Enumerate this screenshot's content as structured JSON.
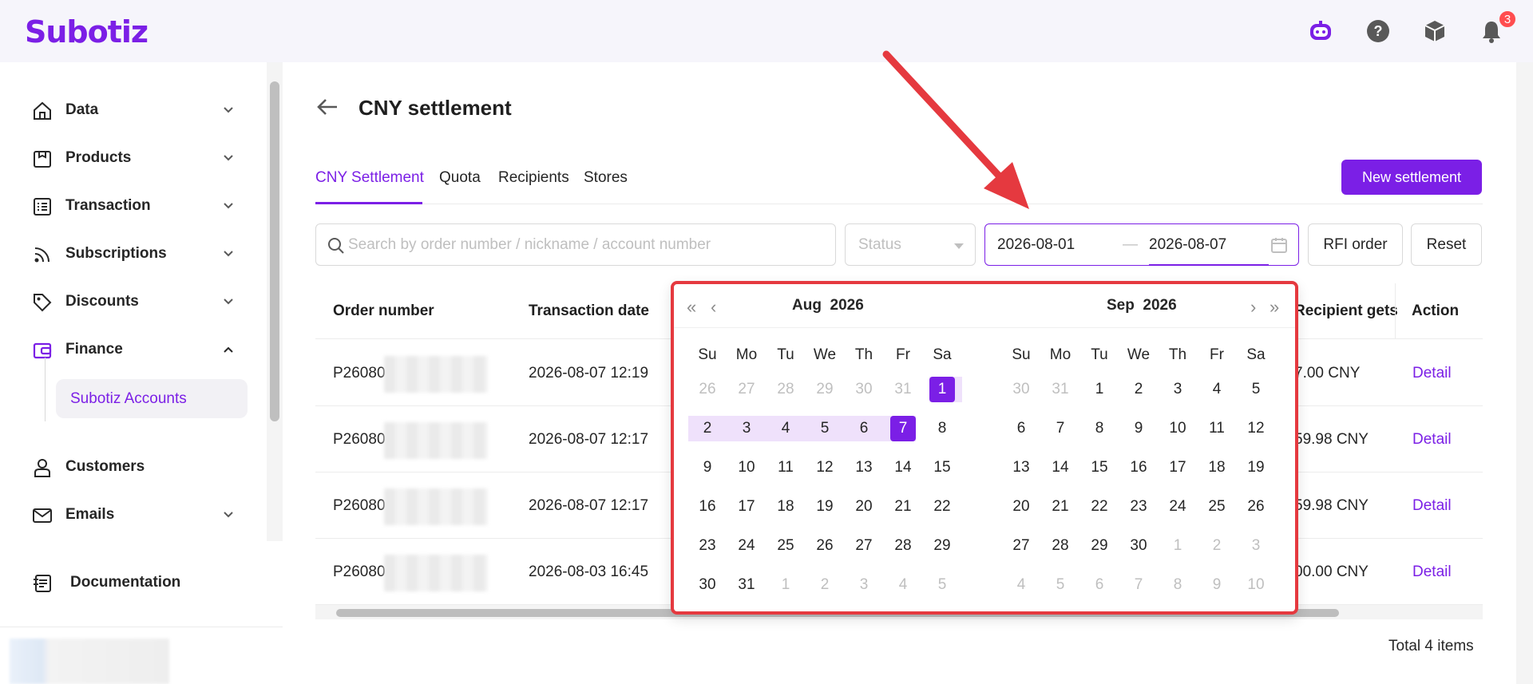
{
  "app": {
    "logo": "Subotiz",
    "notification_count": "3"
  },
  "sidebar": {
    "items": [
      {
        "label": "Data",
        "icon": "home-icon"
      },
      {
        "label": "Products",
        "icon": "box-icon"
      },
      {
        "label": "Transaction",
        "icon": "list-icon"
      },
      {
        "label": "Subscriptions",
        "icon": "rss-icon"
      },
      {
        "label": "Discounts",
        "icon": "tag-icon"
      },
      {
        "label": "Finance",
        "icon": "wallet-icon"
      },
      {
        "label": "Customers",
        "icon": "user-icon"
      },
      {
        "label": "Emails",
        "icon": "mail-icon"
      }
    ],
    "finance_sub": "Subotiz Accounts",
    "documentation": "Documentation"
  },
  "page": {
    "title": "CNY settlement",
    "tabs": [
      "CNY Settlement",
      "Quota",
      "Recipients",
      "Stores"
    ],
    "new_button": "New settlement"
  },
  "filters": {
    "search_placeholder": "Search by order number / nickname / account number",
    "status_placeholder": "Status",
    "date_start": "2026-08-01",
    "date_sep": "—",
    "date_end": "2026-08-07",
    "rfi_button": "RFI order",
    "reset_button": "Reset"
  },
  "table": {
    "headers": {
      "order": "Order number",
      "date": "Transaction date",
      "gets": "Recipient gets",
      "action": "Action"
    },
    "rows": [
      {
        "order": "P26080",
        "date": "2026-08-07 12:19",
        "gets": "7.00 CNY",
        "action": "Detail"
      },
      {
        "order": "P26080",
        "date": "2026-08-07 12:17",
        "gets": "59.98 CNY",
        "action": "Detail"
      },
      {
        "order": "P26080",
        "date": "2026-08-07 12:17",
        "gets": "59.98 CNY",
        "action": "Detail"
      },
      {
        "order": "P26080",
        "date": "2026-08-03 16:45",
        "gets": "00.00 CNY",
        "action": "Detail"
      }
    ],
    "total": "Total 4 items"
  },
  "calendar": {
    "left": {
      "month": "Aug",
      "year": "2026"
    },
    "right": {
      "month": "Sep",
      "year": "2026"
    },
    "weekdays": [
      "Su",
      "Mo",
      "Tu",
      "We",
      "Th",
      "Fr",
      "Sa"
    ],
    "left_days": [
      [
        [
          "26",
          1
        ],
        [
          "27",
          1
        ],
        [
          "28",
          1
        ],
        [
          "29",
          1
        ],
        [
          "30",
          1
        ],
        [
          "31",
          1
        ],
        [
          "1",
          0
        ]
      ],
      [
        [
          "2",
          0
        ],
        [
          "3",
          0
        ],
        [
          "4",
          0
        ],
        [
          "5",
          0
        ],
        [
          "6",
          0
        ],
        [
          "7",
          0
        ],
        [
          "8",
          0
        ]
      ],
      [
        [
          "9",
          0
        ],
        [
          "10",
          0
        ],
        [
          "11",
          0
        ],
        [
          "12",
          0
        ],
        [
          "13",
          0
        ],
        [
          "14",
          0
        ],
        [
          "15",
          0
        ]
      ],
      [
        [
          "16",
          0
        ],
        [
          "17",
          0
        ],
        [
          "18",
          0
        ],
        [
          "19",
          0
        ],
        [
          "20",
          0
        ],
        [
          "21",
          0
        ],
        [
          "22",
          0
        ]
      ],
      [
        [
          "23",
          0
        ],
        [
          "24",
          0
        ],
        [
          "25",
          0
        ],
        [
          "26",
          0
        ],
        [
          "27",
          0
        ],
        [
          "28",
          0
        ],
        [
          "29",
          0
        ]
      ],
      [
        [
          "30",
          0
        ],
        [
          "31",
          0
        ],
        [
          "1",
          1
        ],
        [
          "2",
          1
        ],
        [
          "3",
          1
        ],
        [
          "4",
          1
        ],
        [
          "5",
          1
        ]
      ]
    ],
    "right_days": [
      [
        [
          "30",
          1
        ],
        [
          "31",
          1
        ],
        [
          "1",
          0
        ],
        [
          "2",
          0
        ],
        [
          "3",
          0
        ],
        [
          "4",
          0
        ],
        [
          "5",
          0
        ]
      ],
      [
        [
          "6",
          0
        ],
        [
          "7",
          0
        ],
        [
          "8",
          0
        ],
        [
          "9",
          0
        ],
        [
          "10",
          0
        ],
        [
          "11",
          0
        ],
        [
          "12",
          0
        ]
      ],
      [
        [
          "13",
          0
        ],
        [
          "14",
          0
        ],
        [
          "15",
          0
        ],
        [
          "16",
          0
        ],
        [
          "17",
          0
        ],
        [
          "18",
          0
        ],
        [
          "19",
          0
        ]
      ],
      [
        [
          "20",
          0
        ],
        [
          "21",
          0
        ],
        [
          "22",
          0
        ],
        [
          "23",
          0
        ],
        [
          "24",
          0
        ],
        [
          "25",
          0
        ],
        [
          "26",
          0
        ]
      ],
      [
        [
          "27",
          0
        ],
        [
          "28",
          0
        ],
        [
          "29",
          0
        ],
        [
          "30",
          0
        ],
        [
          "1",
          1
        ],
        [
          "2",
          1
        ],
        [
          "3",
          1
        ]
      ],
      [
        [
          "4",
          1
        ],
        [
          "5",
          1
        ],
        [
          "6",
          1
        ],
        [
          "7",
          1
        ],
        [
          "8",
          1
        ],
        [
          "9",
          1
        ],
        [
          "10",
          1
        ]
      ]
    ],
    "selected_start": "1",
    "selected_end": "7"
  },
  "colors": {
    "accent": "#7b1fe6",
    "annotation": "#e5393f",
    "range": "#efe1fb"
  }
}
